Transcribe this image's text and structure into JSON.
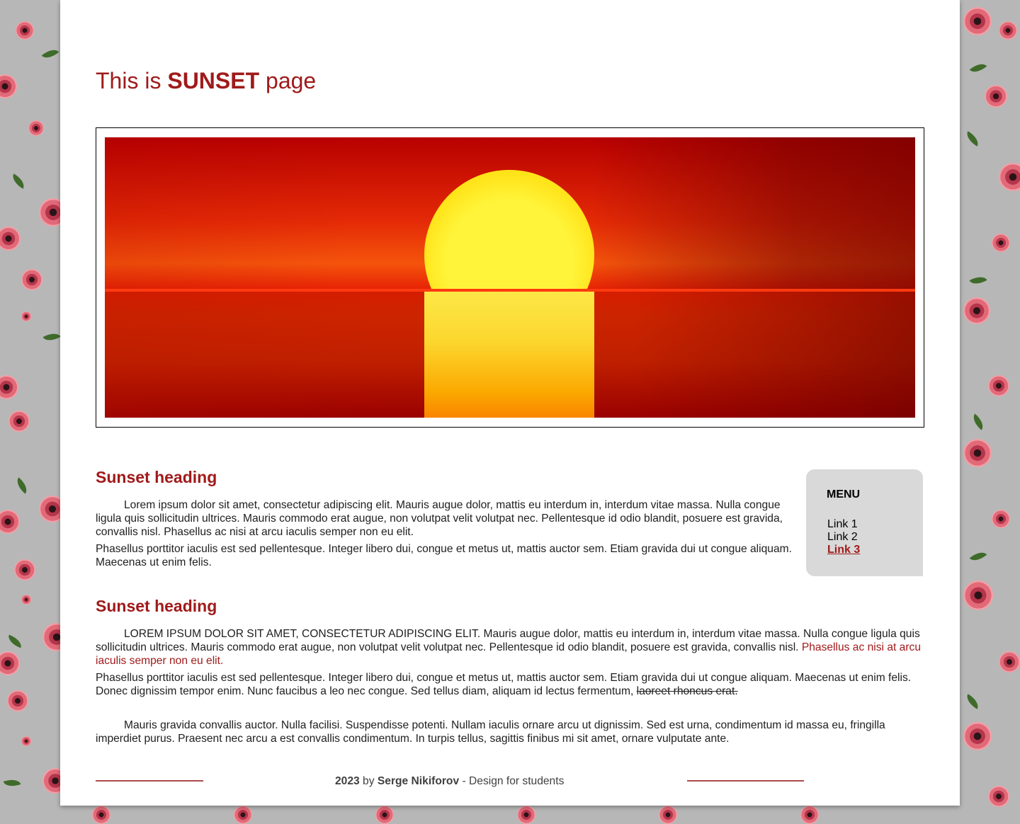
{
  "page": {
    "title_prefix": "This is",
    "title_strong": "SUNSET",
    "title_suffix": "page"
  },
  "hero": {
    "image_icon": "sunset-over-sea-image"
  },
  "sections": [
    {
      "heading": "Sunset heading",
      "p1": "Lorem ipsum dolor sit amet, consectetur adipiscing elit. Mauris augue dolor, mattis eu interdum in, interdum vitae massa. Nulla congue ligula quis sollicitudin ultrices. Mauris commodo erat augue, non volutpat velit volutpat nec. Pellentesque id odio blandit, posuere est gravida, convallis nisl. Phasellus ac nisi at arcu iaculis semper non eu elit.",
      "p2": "Phasellus porttitor iaculis est sed pellentesque. Integer libero dui, congue et metus ut, mattis auctor sem. Etiam gravida dui ut congue aliquam. Maecenas ut enim felis."
    },
    {
      "heading": "Sunset heading",
      "p1_main": "LOREM IPSUM DOLOR SIT AMET, CONSECTETUR ADIPISCING ELIT. Mauris augue dolor, mattis eu interdum in, interdum vitae massa. Nulla congue ligula quis sollicitudin ultrices. Mauris commodo erat augue, non volutpat velit volutpat nec. Pellentesque id odio blandit, posuere est gravida, convallis nisl.",
      "p1_red": "Phasellus ac nisi at arcu iaculis semper non eu elit.",
      "p2_main": "Phasellus porttitor iaculis est sed pellentesque. Integer libero dui, congue et metus ut, mattis auctor sem. Etiam gravida dui ut congue aliquam. Maecenas ut enim felis. Donec dignissim tempor enim. Nunc faucibus a leo nec congue. Sed tellus diam, aliquam id lectus fermentum,",
      "p2_strike": "laoreet rhoncus erat.",
      "p3": "Mauris gravida convallis auctor. Nulla facilisi. Suspendisse potenti. Nullam iaculis ornare arcu ut dignissim. Sed est urna, condimentum id massa eu, fringilla imperdiet purus. Praesent nec arcu a est convallis condimentum. In turpis tellus, sagittis finibus mi sit amet, ornare vulputate ante."
    }
  ],
  "menu": {
    "title": "MENU",
    "items": [
      {
        "label": "Link 1",
        "active": false
      },
      {
        "label": "Link 2",
        "active": false
      },
      {
        "label": "Link 3",
        "active": true
      }
    ]
  },
  "footer": {
    "year": "2023",
    "by": "by",
    "author": "Serge Nikiforov",
    "tagline": "- Design for students"
  },
  "colors": {
    "accent": "#a01a1a",
    "menu_bg": "#d9d9d9",
    "page_bg": "#b7b7b7"
  }
}
